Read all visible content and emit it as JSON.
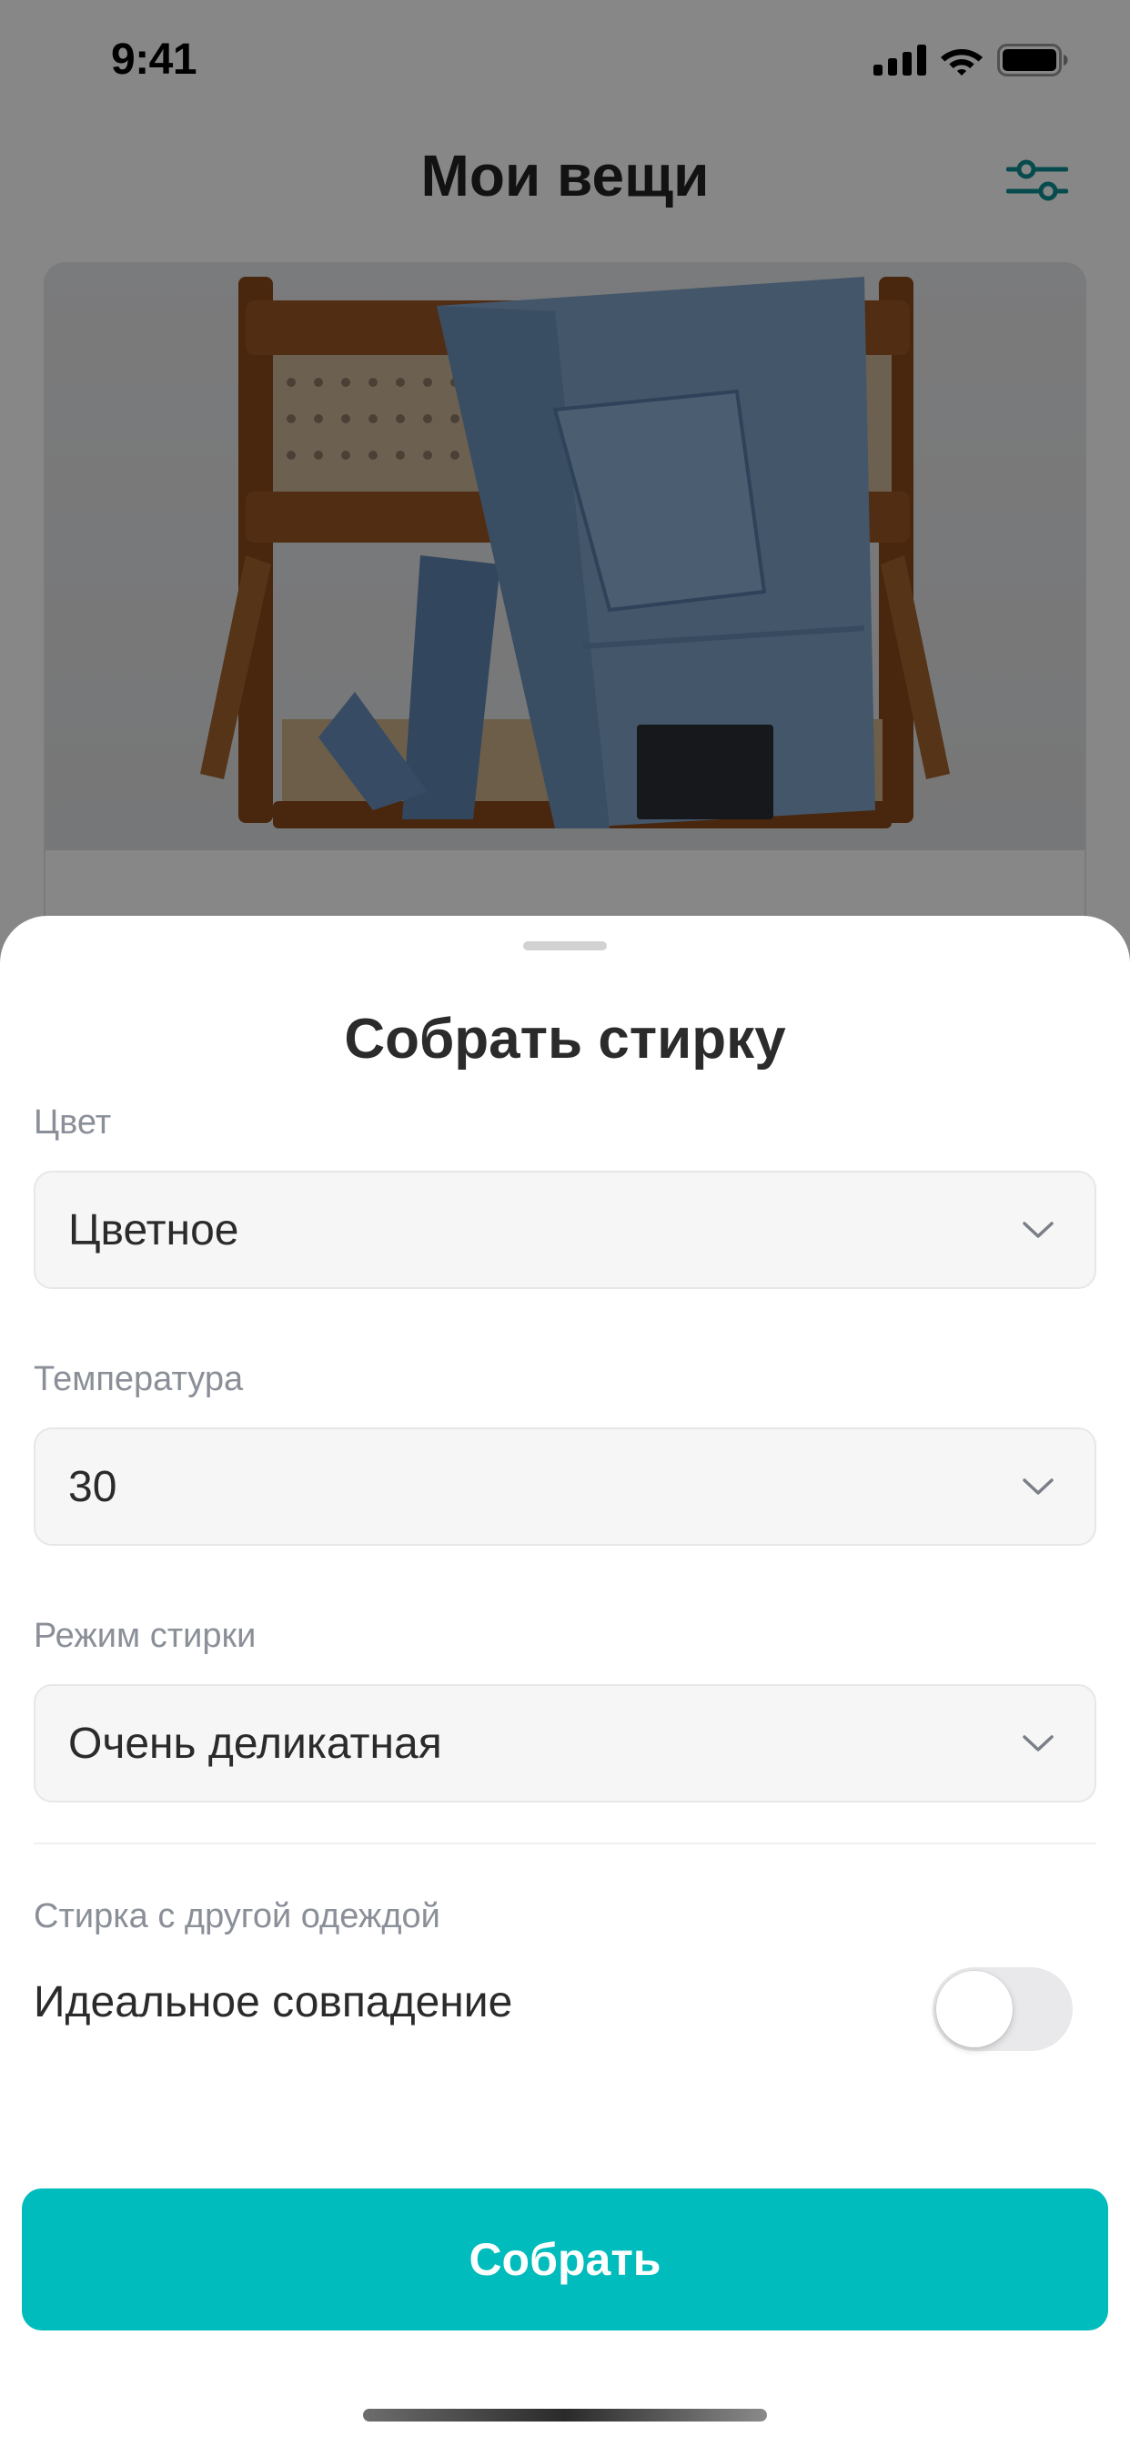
{
  "status_bar": {
    "time": "9:41"
  },
  "header": {
    "title": "Мои вещи",
    "filter_icon": "sliders-icon"
  },
  "colors": {
    "accent": "#00bcbc",
    "scrim": "rgba(0,0,0,0.47)"
  },
  "sheet": {
    "title": "Собрать стирку",
    "fields": [
      {
        "label": "Цвет",
        "value": "Цветное"
      },
      {
        "label": "Температура",
        "value": "30"
      },
      {
        "label": "Режим стирки",
        "value": "Очень деликатная"
      }
    ],
    "mix": {
      "label": "Стирка с другой одеждой",
      "option": "Идеальное совпадение",
      "toggle_on": false
    },
    "submit_label": "Собрать"
  }
}
